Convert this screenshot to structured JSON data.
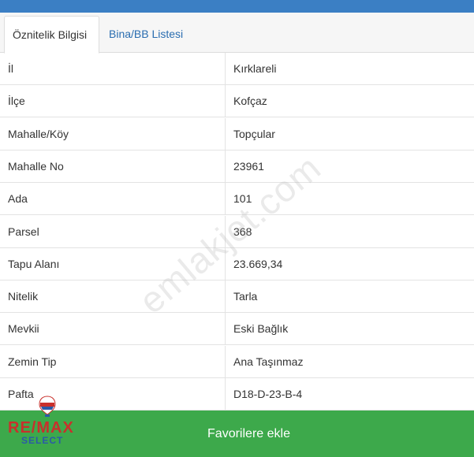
{
  "tabs": {
    "attributes": "Öznitelik Bilgisi",
    "buildings": "Bina/BB Listesi"
  },
  "rows": [
    {
      "key": "İl",
      "value": "Kırklareli"
    },
    {
      "key": "İlçe",
      "value": "Kofçaz"
    },
    {
      "key": "Mahalle/Köy",
      "value": "Topçular"
    },
    {
      "key": "Mahalle No",
      "value": "23961"
    },
    {
      "key": "Ada",
      "value": "101"
    },
    {
      "key": "Parsel",
      "value": "368"
    },
    {
      "key": "Tapu Alanı",
      "value": "23.669,34"
    },
    {
      "key": "Nitelik",
      "value": "Tarla"
    },
    {
      "key": "Mevkii",
      "value": "Eski Bağlık"
    },
    {
      "key": "Zemin Tip",
      "value": "Ana Taşınmaz"
    },
    {
      "key": "Pafta",
      "value": "D18-D-23-B-4"
    }
  ],
  "watermark": "emlakjet.com",
  "favorite_button": "Favorilere ekle",
  "logo": {
    "top": "RE/MAX",
    "bottom": "SELECT"
  },
  "colors": {
    "topbar": "#3b7fc4",
    "tab_link": "#2a6db0",
    "fav_bar": "#3da94b",
    "remax_red": "#c9302c",
    "remax_blue": "#2b5aa8"
  }
}
